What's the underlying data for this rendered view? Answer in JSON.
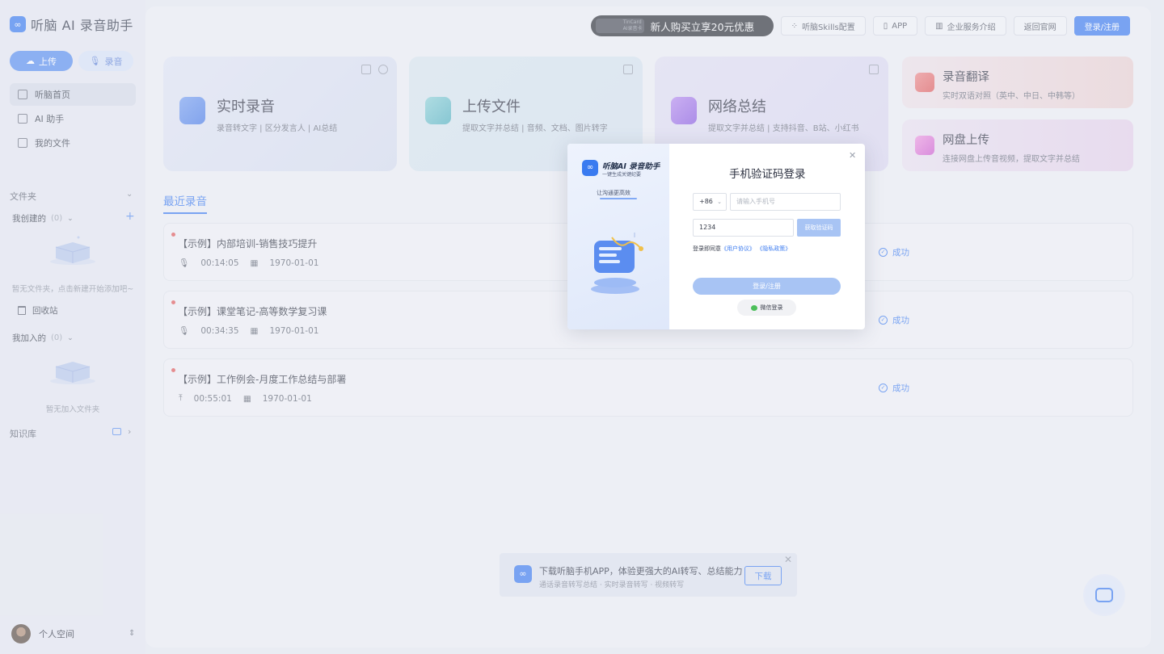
{
  "app": {
    "logo_glyph": "∞",
    "title": "听脑 AI 录音助手"
  },
  "sidebar": {
    "upload_label": "上传",
    "record_label": "录音",
    "nav": [
      {
        "label": "听脑首页",
        "icon": "home-icon"
      },
      {
        "label": "AI 助手",
        "icon": "chat-icon"
      },
      {
        "label": "我的文件",
        "icon": "file-icon"
      }
    ],
    "folders_label": "文件夹",
    "created_label": "我创建的",
    "created_count": "(0)",
    "created_empty": "暂无文件夹，点击新建开始添加吧~",
    "trash_label": "回收站",
    "joined_label": "我加入的",
    "joined_count": "(0)",
    "joined_empty": "暂无加入文件夹",
    "knowledge_label": "知识库",
    "user_label": "个人空间"
  },
  "topbar": {
    "promo_card_line1": "TinCard",
    "promo_card_line2": "AI录音卡",
    "promo_text": "新人购买立享20元优惠",
    "skills": "听脑Skills配置",
    "app": "APP",
    "enterprise": "企业服务介绍",
    "back": "返回官网",
    "login": "登录/注册"
  },
  "cards": [
    {
      "title": "实时录音",
      "sub": "录音转文字 | 区分发言人 | AI总结"
    },
    {
      "title": "上传文件",
      "sub": "提取文字并总结 | 音频、文档、图片转字"
    },
    {
      "title": "网络总结",
      "sub": "提取文字并总结 | 支持抖音、B站、小红书"
    }
  ],
  "side_cards": [
    {
      "title": "录音翻译",
      "sub": "实时双语对照（英中、中日、中韩等）"
    },
    {
      "title": "网盘上传",
      "sub": "连接网盘上传音视频，提取文字并总结"
    }
  ],
  "recent": {
    "title": "最近录音",
    "items": [
      {
        "name": "【示例】内部培训-销售技巧提升",
        "duration": "00:14:05",
        "date": "1970-01-01",
        "status": "成功"
      },
      {
        "name": "【示例】课堂笔记-高等数学复习课",
        "duration": "00:34:35",
        "date": "1970-01-01",
        "status": "成功"
      },
      {
        "name": "【示例】工作例会-月度工作总结与部署",
        "duration": "00:55:01",
        "date": "1970-01-01",
        "status": "成功"
      }
    ]
  },
  "banner": {
    "title": "下载听脑手机APP，体验更强大的AI转写、总结能力",
    "sub": "通话录音转写总结 · 实时录音转写 · 视频转写",
    "button": "下载"
  },
  "modal": {
    "brand": "听脑AI 录音助手",
    "brand_sub": "一键生成关键纪要",
    "tagline": "让沟通更高效",
    "title": "手机验证码登录",
    "country_code": "+86",
    "phone_placeholder": "请输入手机号",
    "code_value": "1234",
    "get_code": "获取验证码",
    "agree_prefix": "登录即同意",
    "user_agreement": "《用户协议》",
    "privacy": "《隐私政策》",
    "login_button": "登录/注册",
    "wechat_login": "微信登录"
  },
  "colors": {
    "accent": "#3d7cf0",
    "success": "#3d7cf0",
    "record_dot": "#e25a5a"
  }
}
